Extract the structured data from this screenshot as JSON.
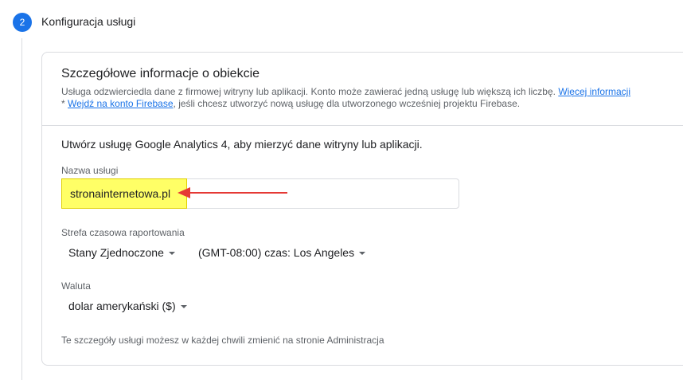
{
  "step": {
    "number": "2",
    "title": "Konfiguracja usługi"
  },
  "card": {
    "title": "Szczegółowe informacje o obiekcie",
    "desc_line1": "Usługa odzwierciedla dane z firmowej witryny lub aplikacji. Konto może zawierać jedną usługę lub większą ich liczbę.",
    "more_info_link": "Więcej informacji",
    "desc_line2_prefix": "* ",
    "firebase_link": "Wejdź na konto Firebase",
    "desc_line2_suffix": ", jeśli chcesz utworzyć nową usługę dla utworzonego wcześniej projektu Firebase."
  },
  "form": {
    "intro": "Utwórz usługę Google Analytics 4, aby mierzyć dane witryny lub aplikacji.",
    "name_label": "Nazwa usługi",
    "name_value": "stronainternetowa.pl",
    "timezone_label": "Strefa czasowa raportowania",
    "country_value": "Stany Zjednoczone",
    "timezone_value": "(GMT-08:00) czas: Los Angeles",
    "currency_label": "Waluta",
    "currency_value": "dolar amerykański ($)",
    "footer_note": "Te szczegóły usługi możesz w każdej chwili zmienić na stronie Administracja"
  },
  "colors": {
    "accent": "#1a73e8",
    "highlight": "#ffff66",
    "arrow": "#e53935"
  }
}
